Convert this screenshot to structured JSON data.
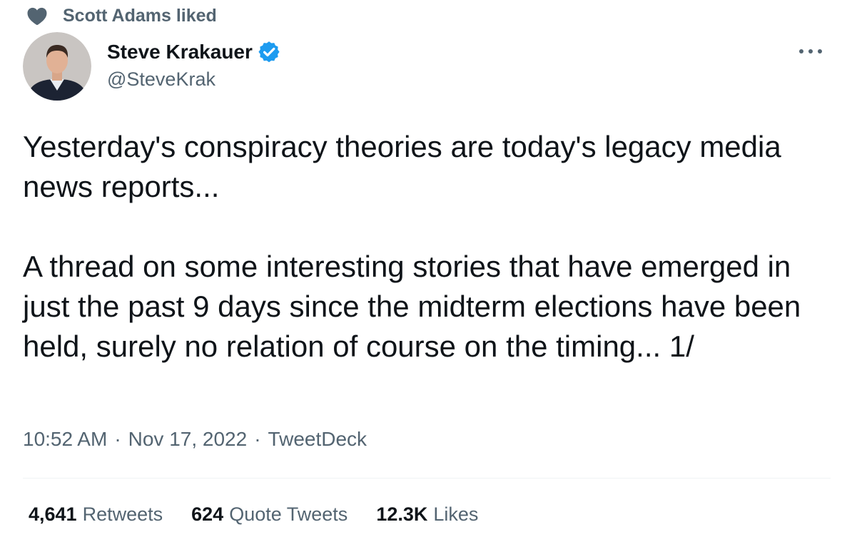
{
  "social_context": {
    "icon": "heart-icon",
    "text": "Scott Adams liked"
  },
  "author": {
    "display_name": "Steve Krakauer",
    "handle": "@SteveKrak",
    "verified": true,
    "verified_color": "#1d9bf0"
  },
  "tweet": {
    "paragraphs": [
      "Yesterday's conspiracy theories are today's legacy media news reports...",
      "A thread on some interesting stories that have emerged in just the past 9 days since the midterm elections have been held, surely no relation of course on the timing... 1/"
    ]
  },
  "meta": {
    "time": "10:52 AM",
    "separator": "·",
    "date": "Nov 17, 2022",
    "source": "TweetDeck"
  },
  "stats": [
    {
      "count": "4,641",
      "label": "Retweets"
    },
    {
      "count": "624",
      "label": "Quote Tweets"
    },
    {
      "count": "12.3K",
      "label": "Likes"
    }
  ],
  "colors": {
    "primary_text": "#0f1419",
    "secondary_text": "#536471",
    "divider": "#eff3f4",
    "accent": "#1d9bf0"
  }
}
